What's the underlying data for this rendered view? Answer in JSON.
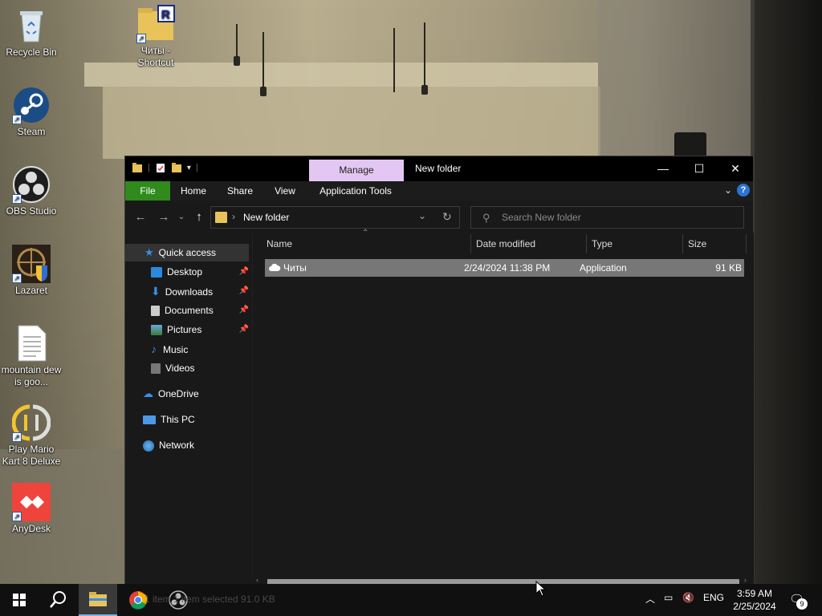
{
  "desktop": {
    "icons": [
      {
        "label": "Recycle Bin",
        "icon": "recycle-bin-icon"
      },
      {
        "label": "Читы - Shortcut",
        "icon": "folder-shortcut-icon"
      },
      {
        "label": "Steam",
        "icon": "steam-icon"
      },
      {
        "label": "OBS Studio",
        "icon": "obs-studio-icon"
      },
      {
        "label": "Lazaret",
        "icon": "lazaret-icon"
      },
      {
        "label": "mountain dew is goo...",
        "icon": "text-file-icon"
      },
      {
        "label": "Play Mario Kart 8 Deluxe",
        "icon": "yuzu-icon"
      },
      {
        "label": "AnyDesk",
        "icon": "anydesk-icon"
      }
    ]
  },
  "window": {
    "manage_tab": "Manage",
    "title": "New folder",
    "ribbon_tabs": [
      "File",
      "Home",
      "Share",
      "View",
      "Application Tools"
    ],
    "address": "New folder",
    "search_placeholder": "Search New folder",
    "sidebar": [
      {
        "label": "Quick access",
        "icon": "star-icon",
        "pinned": false
      },
      {
        "label": "Desktop",
        "icon": "desktop-icon",
        "pinned": true
      },
      {
        "label": "Downloads",
        "icon": "download-icon",
        "pinned": true
      },
      {
        "label": "Documents",
        "icon": "documents-icon",
        "pinned": true
      },
      {
        "label": "Pictures",
        "icon": "pictures-icon",
        "pinned": true
      },
      {
        "label": "Music",
        "icon": "music-icon",
        "pinned": false
      },
      {
        "label": "Videos",
        "icon": "videos-icon",
        "pinned": false
      },
      {
        "label": "OneDrive",
        "icon": "cloud-icon",
        "pinned": false
      },
      {
        "label": "This PC",
        "icon": "computer-icon",
        "pinned": false
      },
      {
        "label": "Network",
        "icon": "network-icon",
        "pinned": false
      }
    ],
    "columns": [
      "Name",
      "Date modified",
      "Type",
      "Size"
    ],
    "files": [
      {
        "name": "Читы",
        "date": "2/24/2024 11:38 PM",
        "type": "Application",
        "size": "91 KB"
      }
    ]
  },
  "taskbar": {
    "status_ghost": "1 item   1 item selected  91.0 KB",
    "language": "ENG",
    "time": "3:59 AM",
    "date": "2/25/2024",
    "notifications": "9"
  },
  "colors": {
    "file_tab": "#2e8b1c",
    "manage_tab": "#e3c6f2",
    "selected_row": "#777777",
    "folder": "#e8c35a"
  }
}
